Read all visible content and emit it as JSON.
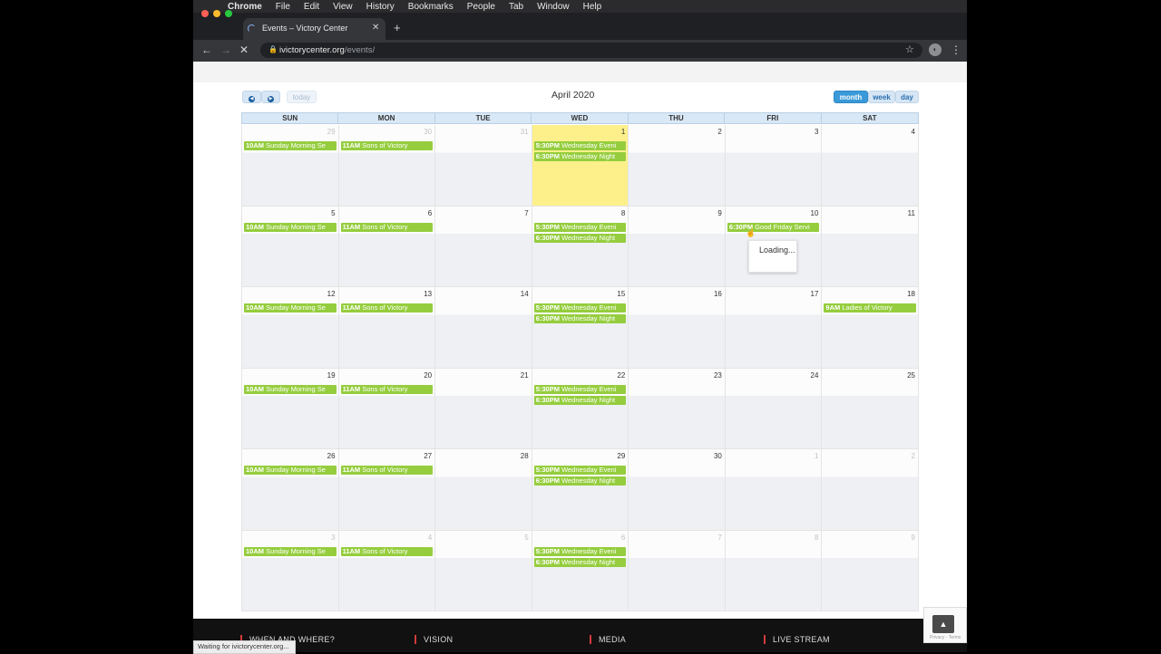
{
  "menubar": {
    "items": [
      "Chrome",
      "File",
      "Edit",
      "View",
      "History",
      "Bookmarks",
      "People",
      "Tab",
      "Window",
      "Help"
    ]
  },
  "browser": {
    "tab_title": "Events – Victory Center",
    "url_domain": "ivictorycenter.org",
    "url_path": "/events/",
    "status_text": "Waiting for ivictorycenter.org..."
  },
  "calendar": {
    "title": "April 2020",
    "today_label": "today",
    "views": [
      {
        "label": "month",
        "active": true
      },
      {
        "label": "week",
        "active": false
      },
      {
        "label": "day",
        "active": false
      }
    ],
    "weekdays": [
      "SUN",
      "MON",
      "TUE",
      "WED",
      "THU",
      "FRI",
      "SAT"
    ],
    "weeks": [
      [
        {
          "day": "29",
          "other": true,
          "events": [
            {
              "time": "10AM",
              "title": "Sunday Morning Se"
            }
          ]
        },
        {
          "day": "30",
          "other": true,
          "events": [
            {
              "time": "11AM",
              "title": "Sons of Victory"
            }
          ]
        },
        {
          "day": "31",
          "other": true,
          "events": []
        },
        {
          "day": "1",
          "today": true,
          "events": [
            {
              "time": "5:30PM",
              "title": "Wednesday Eveni"
            },
            {
              "time": "6:30PM",
              "title": "Wednesday Night"
            }
          ]
        },
        {
          "day": "2",
          "events": []
        },
        {
          "day": "3",
          "events": []
        },
        {
          "day": "4",
          "events": []
        }
      ],
      [
        {
          "day": "5",
          "events": [
            {
              "time": "10AM",
              "title": "Sunday Morning Se"
            }
          ]
        },
        {
          "day": "6",
          "events": [
            {
              "time": "11AM",
              "title": "Sons of Victory"
            }
          ]
        },
        {
          "day": "7",
          "events": []
        },
        {
          "day": "8",
          "events": [
            {
              "time": "5:30PM",
              "title": "Wednesday Eveni"
            },
            {
              "time": "6:30PM",
              "title": "Wednesday Night"
            }
          ]
        },
        {
          "day": "9",
          "events": []
        },
        {
          "day": "10",
          "events": [
            {
              "time": "6:30PM",
              "title": "Good Friday Servi"
            }
          ]
        },
        {
          "day": "11",
          "events": []
        }
      ],
      [
        {
          "day": "12",
          "events": [
            {
              "time": "10AM",
              "title": "Sunday Morning Se"
            }
          ]
        },
        {
          "day": "13",
          "events": [
            {
              "time": "11AM",
              "title": "Sons of Victory"
            }
          ]
        },
        {
          "day": "14",
          "events": []
        },
        {
          "day": "15",
          "events": [
            {
              "time": "5:30PM",
              "title": "Wednesday Eveni"
            },
            {
              "time": "6:30PM",
              "title": "Wednesday Night"
            }
          ]
        },
        {
          "day": "16",
          "events": []
        },
        {
          "day": "17",
          "events": []
        },
        {
          "day": "18",
          "events": [
            {
              "time": "9AM",
              "title": "Ladies of Victory"
            }
          ]
        }
      ],
      [
        {
          "day": "19",
          "events": [
            {
              "time": "10AM",
              "title": "Sunday Morning Se"
            }
          ]
        },
        {
          "day": "20",
          "events": [
            {
              "time": "11AM",
              "title": "Sons of Victory"
            }
          ]
        },
        {
          "day": "21",
          "events": []
        },
        {
          "day": "22",
          "events": [
            {
              "time": "5:30PM",
              "title": "Wednesday Eveni"
            },
            {
              "time": "6:30PM",
              "title": "Wednesday Night"
            }
          ]
        },
        {
          "day": "23",
          "events": []
        },
        {
          "day": "24",
          "events": []
        },
        {
          "day": "25",
          "events": []
        }
      ],
      [
        {
          "day": "26",
          "events": [
            {
              "time": "10AM",
              "title": "Sunday Morning Se"
            }
          ]
        },
        {
          "day": "27",
          "events": [
            {
              "time": "11AM",
              "title": "Sons of Victory"
            }
          ]
        },
        {
          "day": "28",
          "events": []
        },
        {
          "day": "29",
          "events": [
            {
              "time": "5:30PM",
              "title": "Wednesday Eveni"
            },
            {
              "time": "6:30PM",
              "title": "Wednesday Night"
            }
          ]
        },
        {
          "day": "30",
          "events": []
        },
        {
          "day": "1",
          "other": true,
          "events": []
        },
        {
          "day": "2",
          "other": true,
          "events": []
        }
      ],
      [
        {
          "day": "3",
          "other": true,
          "events": [
            {
              "time": "10AM",
              "title": "Sunday Morning Se"
            }
          ]
        },
        {
          "day": "4",
          "other": true,
          "events": [
            {
              "time": "11AM",
              "title": "Sons of Victory"
            }
          ]
        },
        {
          "day": "5",
          "other": true,
          "events": []
        },
        {
          "day": "6",
          "other": true,
          "events": [
            {
              "time": "5:30PM",
              "title": "Wednesday Eveni"
            },
            {
              "time": "6:30PM",
              "title": "Wednesday Night"
            }
          ]
        },
        {
          "day": "7",
          "other": true,
          "events": []
        },
        {
          "day": "8",
          "other": true,
          "events": []
        },
        {
          "day": "9",
          "other": true,
          "events": []
        }
      ]
    ],
    "tooltip_text": "Loading..."
  },
  "footer": {
    "items": [
      "WHEN AND WHERE?",
      "VISION",
      "MEDIA",
      "LIVE STREAM"
    ]
  },
  "recaptcha": {
    "terms": "Privacy - Terms"
  },
  "colors": {
    "event": "#95cd3e",
    "today": "#fdf08b",
    "accent": "#3a9ad9",
    "footer_marker": "#d23b3b"
  }
}
